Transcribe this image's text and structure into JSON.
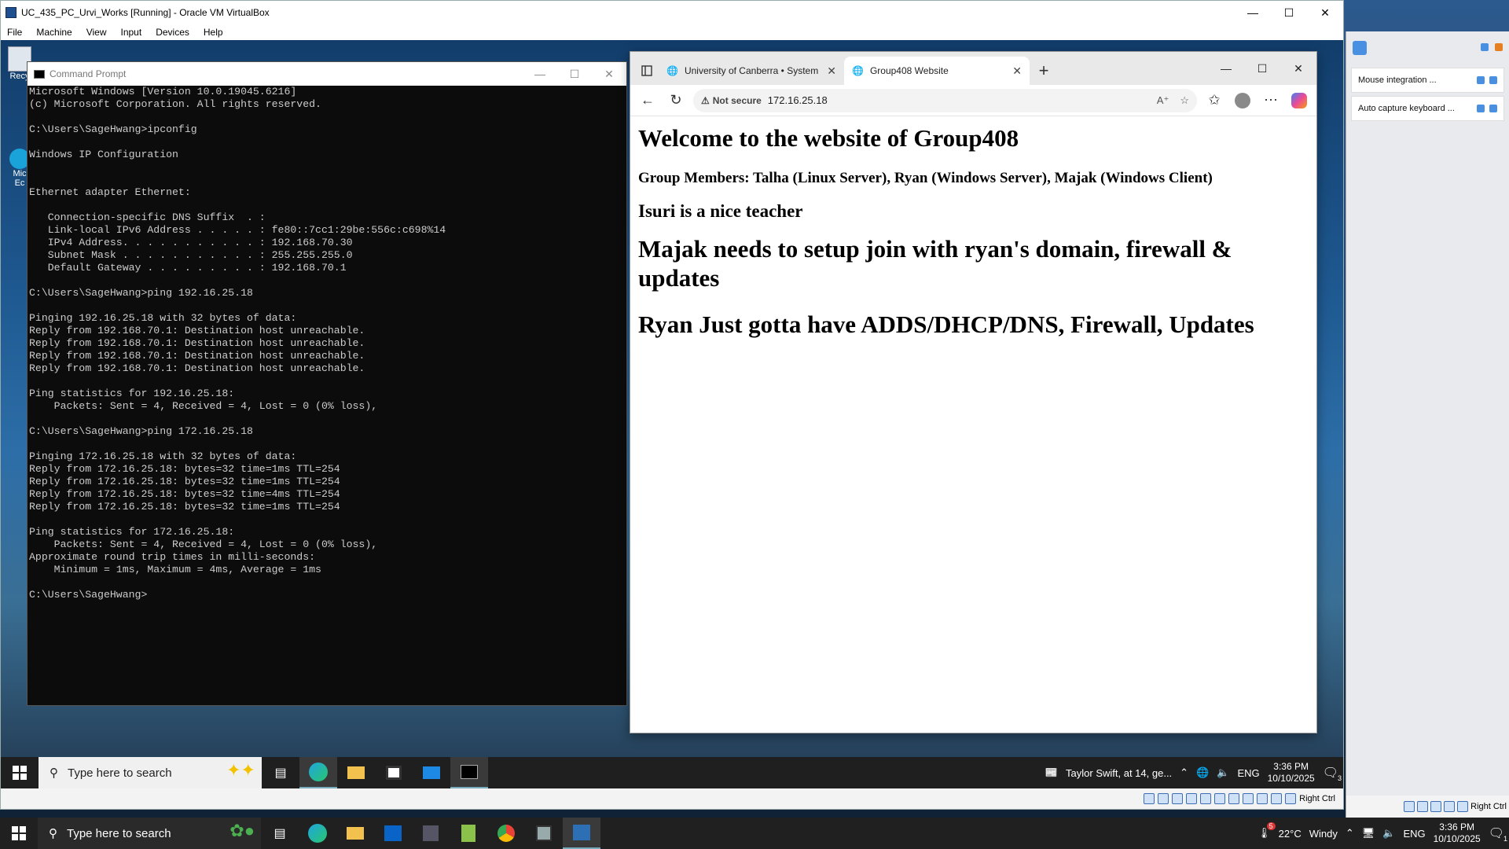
{
  "vbox": {
    "title": "UC_435_PC_Urvi_Works [Running] - Oracle VM VirtualBox",
    "menu": [
      "File",
      "Machine",
      "View",
      "Input",
      "Devices",
      "Help"
    ],
    "status_text": "Right Ctrl"
  },
  "cmd": {
    "title": "Command Prompt",
    "lines": [
      "Microsoft Windows [Version 10.0.19045.6216]",
      "(c) Microsoft Corporation. All rights reserved.",
      "",
      "C:\\Users\\SageHwang>ipconfig",
      "",
      "Windows IP Configuration",
      "",
      "",
      "Ethernet adapter Ethernet:",
      "",
      "   Connection-specific DNS Suffix  . :",
      "   Link-local IPv6 Address . . . . . : fe80::7cc1:29be:556c:c698%14",
      "   IPv4 Address. . . . . . . . . . . : 192.168.70.30",
      "   Subnet Mask . . . . . . . . . . . : 255.255.255.0",
      "   Default Gateway . . . . . . . . . : 192.168.70.1",
      "",
      "C:\\Users\\SageHwang>ping 192.16.25.18",
      "",
      "Pinging 192.16.25.18 with 32 bytes of data:",
      "Reply from 192.168.70.1: Destination host unreachable.",
      "Reply from 192.168.70.1: Destination host unreachable.",
      "Reply from 192.168.70.1: Destination host unreachable.",
      "Reply from 192.168.70.1: Destination host unreachable.",
      "",
      "Ping statistics for 192.16.25.18:",
      "    Packets: Sent = 4, Received = 4, Lost = 0 (0% loss),",
      "",
      "C:\\Users\\SageHwang>ping 172.16.25.18",
      "",
      "Pinging 172.16.25.18 with 32 bytes of data:",
      "Reply from 172.16.25.18: bytes=32 time=1ms TTL=254",
      "Reply from 172.16.25.18: bytes=32 time=1ms TTL=254",
      "Reply from 172.16.25.18: bytes=32 time=4ms TTL=254",
      "Reply from 172.16.25.18: bytes=32 time=1ms TTL=254",
      "",
      "Ping statistics for 172.16.25.18:",
      "    Packets: Sent = 4, Received = 4, Lost = 0 (0% loss),",
      "Approximate round trip times in milli-seconds:",
      "    Minimum = 1ms, Maximum = 4ms, Average = 1ms",
      "",
      "C:\\Users\\SageHwang>"
    ]
  },
  "desktop_icons": {
    "recycle": "Recy",
    "edge1": "Mic",
    "edge2": "Ec"
  },
  "edge": {
    "tabs": [
      {
        "label": "University of Canberra • System &",
        "active": false
      },
      {
        "label": "Group408 Website",
        "active": true
      }
    ],
    "not_secure": "Not secure",
    "url": "172.16.25.18"
  },
  "page": {
    "h1": "Welcome to the website of Group408",
    "members": "Group Members: Talha (Linux Server), Ryan (Windows Server), Majak (Windows Client)",
    "teacher": "Isuri is a nice teacher",
    "majak": "Majak needs to setup join with ryan's domain, firewall & updates",
    "ryan": "Ryan Just gotta have ADDS/DHCP/DNS, Firewall, Updates"
  },
  "guest_taskbar": {
    "search_placeholder": "Type here to search",
    "news": "Taylor Swift, at 14, ge...",
    "lang": "ENG",
    "time": "3:36 PM",
    "date": "10/10/2025",
    "notif_count": "3"
  },
  "side_panel": {
    "notices": [
      "Mouse integration ...",
      "Auto capture keyboard ..."
    ],
    "status_text": "Right Ctrl"
  },
  "host_taskbar": {
    "search_placeholder": "Type here to search",
    "weather_badge": "5",
    "temperature": "22°C",
    "weather": "Windy",
    "lang": "ENG",
    "time": "3:36 PM",
    "date": "10/10/2025",
    "notif_count": "1"
  }
}
